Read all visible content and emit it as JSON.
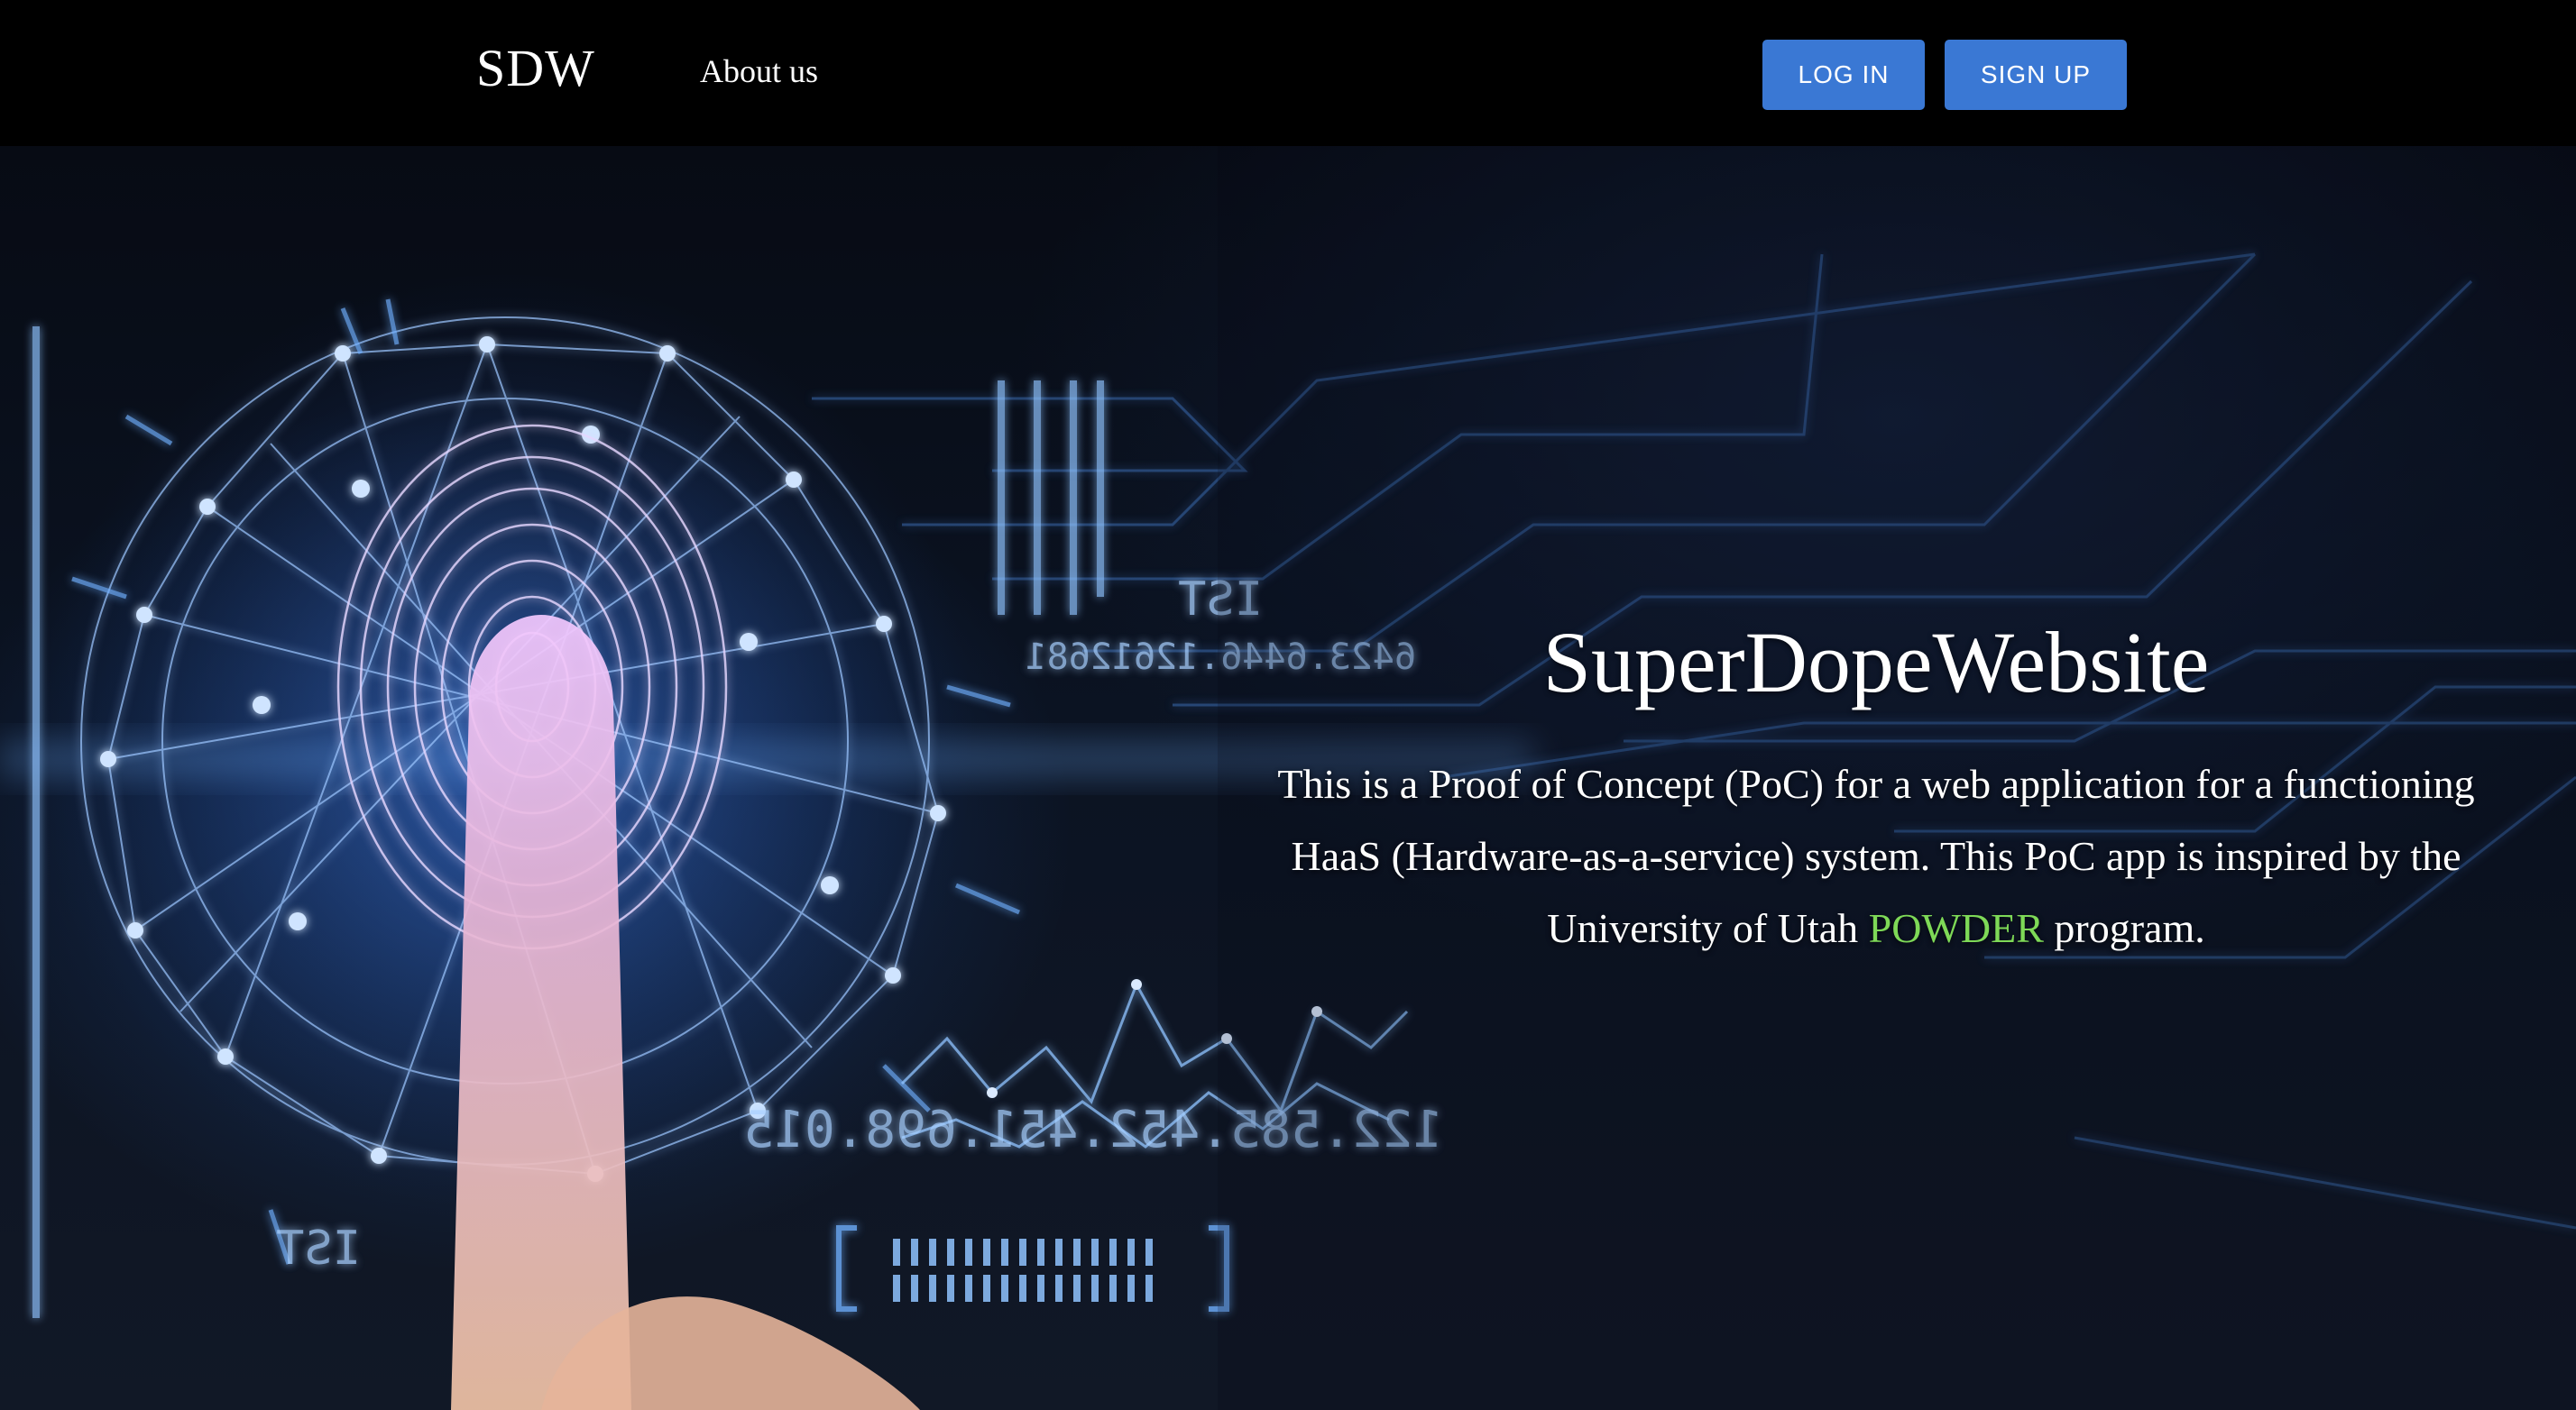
{
  "navbar": {
    "brand": "SDW",
    "about_label": "About us",
    "login_label": "LOG IN",
    "signup_label": "SIGN UP"
  },
  "hero": {
    "title": "SuperDopeWebsite",
    "description_before": "This is a Proof of Concept (PoC) for a web application for a functioning HaaS (Hardware-as-a-service) system. This PoC app is inspired by the University of Utah ",
    "description_highlight": "POWDER",
    "description_after": " program.",
    "background_numbers_1": "122.585.452.451.698.015",
    "background_numbers_2": "6423.6446.12612681",
    "background_label_1": "IST",
    "background_label_2": "IST"
  },
  "colors": {
    "navbar_bg": "#000000",
    "button_bg": "#3a78d4",
    "highlight": "#7ed957",
    "text": "#ffffff"
  },
  "icons": {
    "background_image": "fingerprint-circuit-image"
  }
}
